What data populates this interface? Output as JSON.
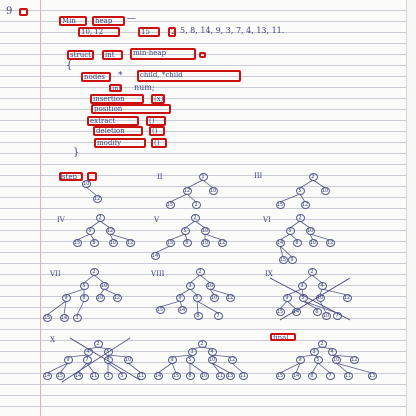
{
  "question_number": "9",
  "title": {
    "word1": "Min",
    "word2": "heap"
  },
  "sequence": {
    "prefix": "10, 12",
    "v1": "15",
    "v2": "2",
    "rest": "5, 8, 14, 9, 3, 7, 4, 13, 11."
  },
  "tree_labels": [
    "I",
    "II",
    "III",
    "IV",
    "V",
    "VI",
    "VII",
    "VIII",
    "IX",
    "X"
  ],
  "colors": {
    "ink": "#3a3f78",
    "highlight_box": "#cc1111",
    "rule_line": "#c9ccd6"
  },
  "trees": [
    {
      "nodes": [
        [
          "10",
          86,
          184
        ],
        [
          "12",
          97,
          199
        ]
      ]
    },
    {
      "nodes": [
        [
          "1",
          203,
          177
        ],
        [
          "12",
          187,
          191
        ],
        [
          "10",
          213,
          191
        ],
        [
          "15",
          170,
          205
        ],
        [
          "2",
          196,
          205
        ]
      ]
    },
    {
      "nodes": [
        [
          "2",
          313,
          177
        ],
        [
          "5",
          300,
          191
        ],
        [
          "10",
          325,
          191
        ],
        [
          "15",
          280,
          205
        ],
        [
          "12",
          305,
          205
        ]
      ]
    },
    {
      "nodes": [
        [
          "2",
          100,
          218
        ],
        [
          "5",
          90,
          231
        ],
        [
          "12",
          110,
          231
        ],
        [
          "15",
          77,
          243
        ],
        [
          "8",
          94,
          243
        ],
        [
          "10",
          113,
          243
        ],
        [
          "12",
          130,
          243
        ]
      ]
    },
    {
      "nodes": [
        [
          "2",
          195,
          218
        ],
        [
          "5",
          185,
          231
        ],
        [
          "10",
          205,
          231
        ],
        [
          "15",
          170,
          243
        ],
        [
          "8",
          187,
          243
        ],
        [
          "10",
          205,
          243
        ],
        [
          "12",
          222,
          243
        ],
        [
          "14",
          155,
          256
        ]
      ]
    },
    {
      "nodes": [
        [
          "2",
          300,
          218
        ],
        [
          "5",
          290,
          231
        ],
        [
          "10",
          310,
          231
        ],
        [
          "14",
          280,
          243
        ],
        [
          "8",
          297,
          243
        ],
        [
          "10",
          313,
          243
        ],
        [
          "12",
          330,
          243
        ],
        [
          "15",
          283,
          260
        ],
        [
          "9",
          292,
          260
        ]
      ]
    },
    {
      "nodes": [
        [
          "2",
          94,
          272
        ],
        [
          "5",
          84,
          286
        ],
        [
          "10",
          104,
          286
        ],
        [
          "9",
          66,
          298
        ],
        [
          "8",
          84,
          298
        ],
        [
          "10",
          100,
          298
        ],
        [
          "12",
          117,
          298
        ],
        [
          "15",
          47,
          318
        ],
        [
          "14",
          64,
          318
        ],
        [
          "3",
          77,
          318
        ]
      ]
    },
    {
      "nodes": [
        [
          "2",
          200,
          272
        ],
        [
          "3",
          190,
          286
        ],
        [
          "10",
          210,
          286
        ],
        [
          "9",
          180,
          298
        ],
        [
          "5",
          197,
          298
        ],
        [
          "10",
          214,
          298
        ],
        [
          "12",
          230,
          298
        ],
        [
          "15",
          160,
          310
        ],
        [
          "14",
          182,
          310
        ],
        [
          "8",
          198,
          316
        ],
        [
          "7",
          218,
          316
        ]
      ]
    },
    {
      "nodes": [
        [
          "2",
          312,
          272
        ],
        [
          "3",
          302,
          286
        ],
        [
          "4",
          322,
          286
        ],
        [
          "9",
          287,
          298
        ],
        [
          "5",
          303,
          298
        ],
        [
          "10",
          320,
          298
        ],
        [
          "12",
          347,
          298
        ],
        [
          "15",
          280,
          312
        ],
        [
          "14",
          296,
          312
        ],
        [
          "8",
          317,
          312
        ],
        [
          "7",
          337,
          316
        ],
        [
          "10",
          326,
          316
        ]
      ]
    },
    {
      "nodes": [
        [
          "2",
          98,
          344
        ],
        [
          "4",
          88,
          352
        ],
        [
          "5",
          108,
          352
        ],
        [
          "9",
          68,
          360
        ],
        [
          "7",
          87,
          360
        ],
        [
          "8",
          108,
          360
        ],
        [
          "10",
          128,
          360
        ],
        [
          "14",
          47,
          376
        ],
        [
          "15",
          60,
          376
        ],
        [
          "14",
          78,
          376
        ],
        [
          "11",
          94,
          376
        ],
        [
          "3",
          108,
          376
        ],
        [
          "5",
          122,
          376
        ],
        [
          "11",
          141,
          376
        ]
      ]
    },
    {
      "nodes": [
        [
          "2",
          202,
          344
        ],
        [
          "3",
          192,
          352
        ],
        [
          "4",
          212,
          352
        ],
        [
          "9",
          172,
          360
        ],
        [
          "5",
          190,
          360
        ],
        [
          "10",
          212,
          360
        ],
        [
          "12",
          232,
          360
        ],
        [
          "14",
          158,
          376
        ],
        [
          "15",
          176,
          376
        ],
        [
          "8",
          190,
          376
        ],
        [
          "10",
          204,
          376
        ],
        [
          "11",
          220,
          376
        ],
        [
          "13",
          230,
          376
        ],
        [
          "11",
          243,
          376
        ]
      ]
    },
    {
      "nodes": [
        [
          "2",
          322,
          344
        ],
        [
          "3",
          314,
          352
        ],
        [
          "4",
          332,
          352
        ],
        [
          "9",
          300,
          360
        ],
        [
          "5",
          318,
          360
        ],
        [
          "10",
          336,
          360
        ],
        [
          "12",
          354,
          360
        ],
        [
          "15",
          280,
          376
        ],
        [
          "14",
          296,
          376
        ],
        [
          "8",
          312,
          376
        ],
        [
          "7",
          330,
          376
        ],
        [
          "11",
          348,
          376
        ],
        [
          "13",
          372,
          376
        ]
      ]
    }
  ],
  "code": {
    "decl_left": "struct",
    "decl_right": "child",
    "root_kw": "int",
    "struct_kw": "int",
    "type": "min-heap",
    "brace_open": "{",
    "field1": {
      "left": "nodes",
      "mid": "*",
      "right": "child, *child"
    },
    "field2": {
      "left": "int",
      "right": "num;"
    },
    "fn1": {
      "name": "insertion",
      "arg": "(x)"
    },
    "fn2": {
      "name": "position",
      "arg": "(x)"
    },
    "fn3": {
      "name": "extract",
      "arg": "()"
    },
    "fn4": {
      "name": "deletion",
      "arg": "()"
    },
    "fn5": {
      "name": "modify",
      "arg": "()"
    },
    "brace_close": "}"
  },
  "step_label": "step 1",
  "final_label": "final"
}
